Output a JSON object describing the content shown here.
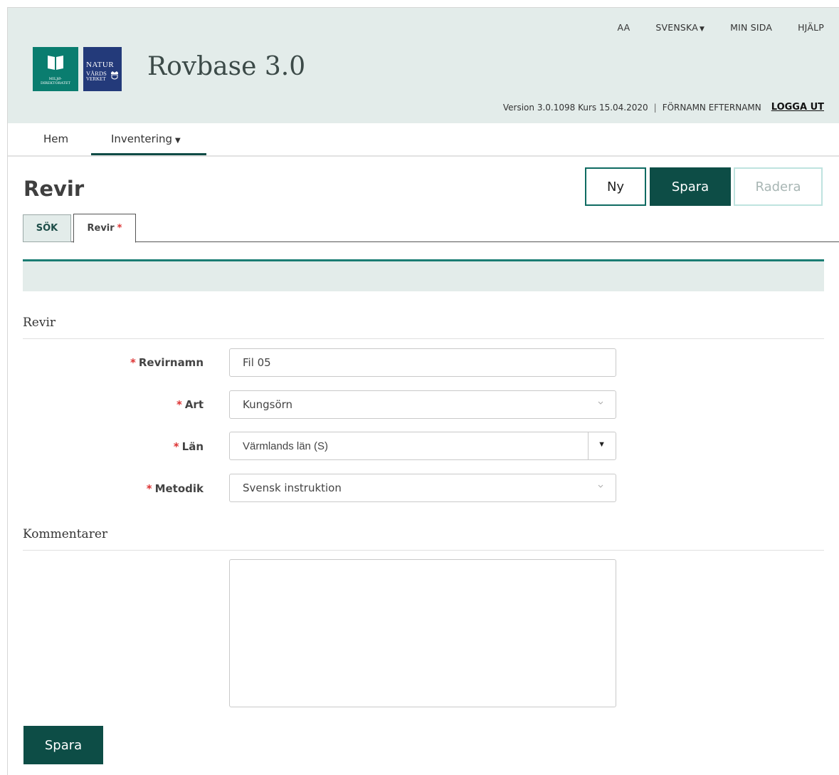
{
  "header": {
    "topnav": {
      "font_size": "AA",
      "language": "SVENSKA",
      "my_page": "MIN SIDA",
      "help": "HJÄLP"
    },
    "logos": {
      "miljo": [
        "MILJØ-",
        "DIREKTORATET"
      ],
      "natur": [
        "NATUR",
        "VÅRDS",
        "VERKET"
      ]
    },
    "app_title": "Rovbase 3.0",
    "version": "Version 3.0.1098 Kurs 15.04.2020",
    "separator": "|",
    "user": "FÖRNAMN EFTERNAMN",
    "logout": "LOGGA UT"
  },
  "mainnav": {
    "home": "Hem",
    "inventory": "Inventering"
  },
  "page": {
    "title": "Revir",
    "buttons": {
      "new": "Ny",
      "save": "Spara",
      "delete": "Radera"
    },
    "tabs": {
      "search": "SÖK",
      "revir": "Revir",
      "revir_marker": "*"
    }
  },
  "form": {
    "section_title": "Revir",
    "required_marker": "*",
    "fields": {
      "name": {
        "label": "Revirnamn",
        "value": "Fil 05"
      },
      "species": {
        "label": "Art",
        "value": "Kungsörn"
      },
      "county": {
        "label": "Län",
        "value": "Värmlands län (S)"
      },
      "method": {
        "label": "Metodik",
        "value": "Svensk instruktion"
      }
    },
    "comments_title": "Kommentarer",
    "comments_value": "",
    "save_button": "Spara"
  },
  "colors": {
    "header_bg": "#e3ecea",
    "primary": "#0d4d46",
    "accent": "#1a7d73",
    "required": "#dd3333"
  }
}
